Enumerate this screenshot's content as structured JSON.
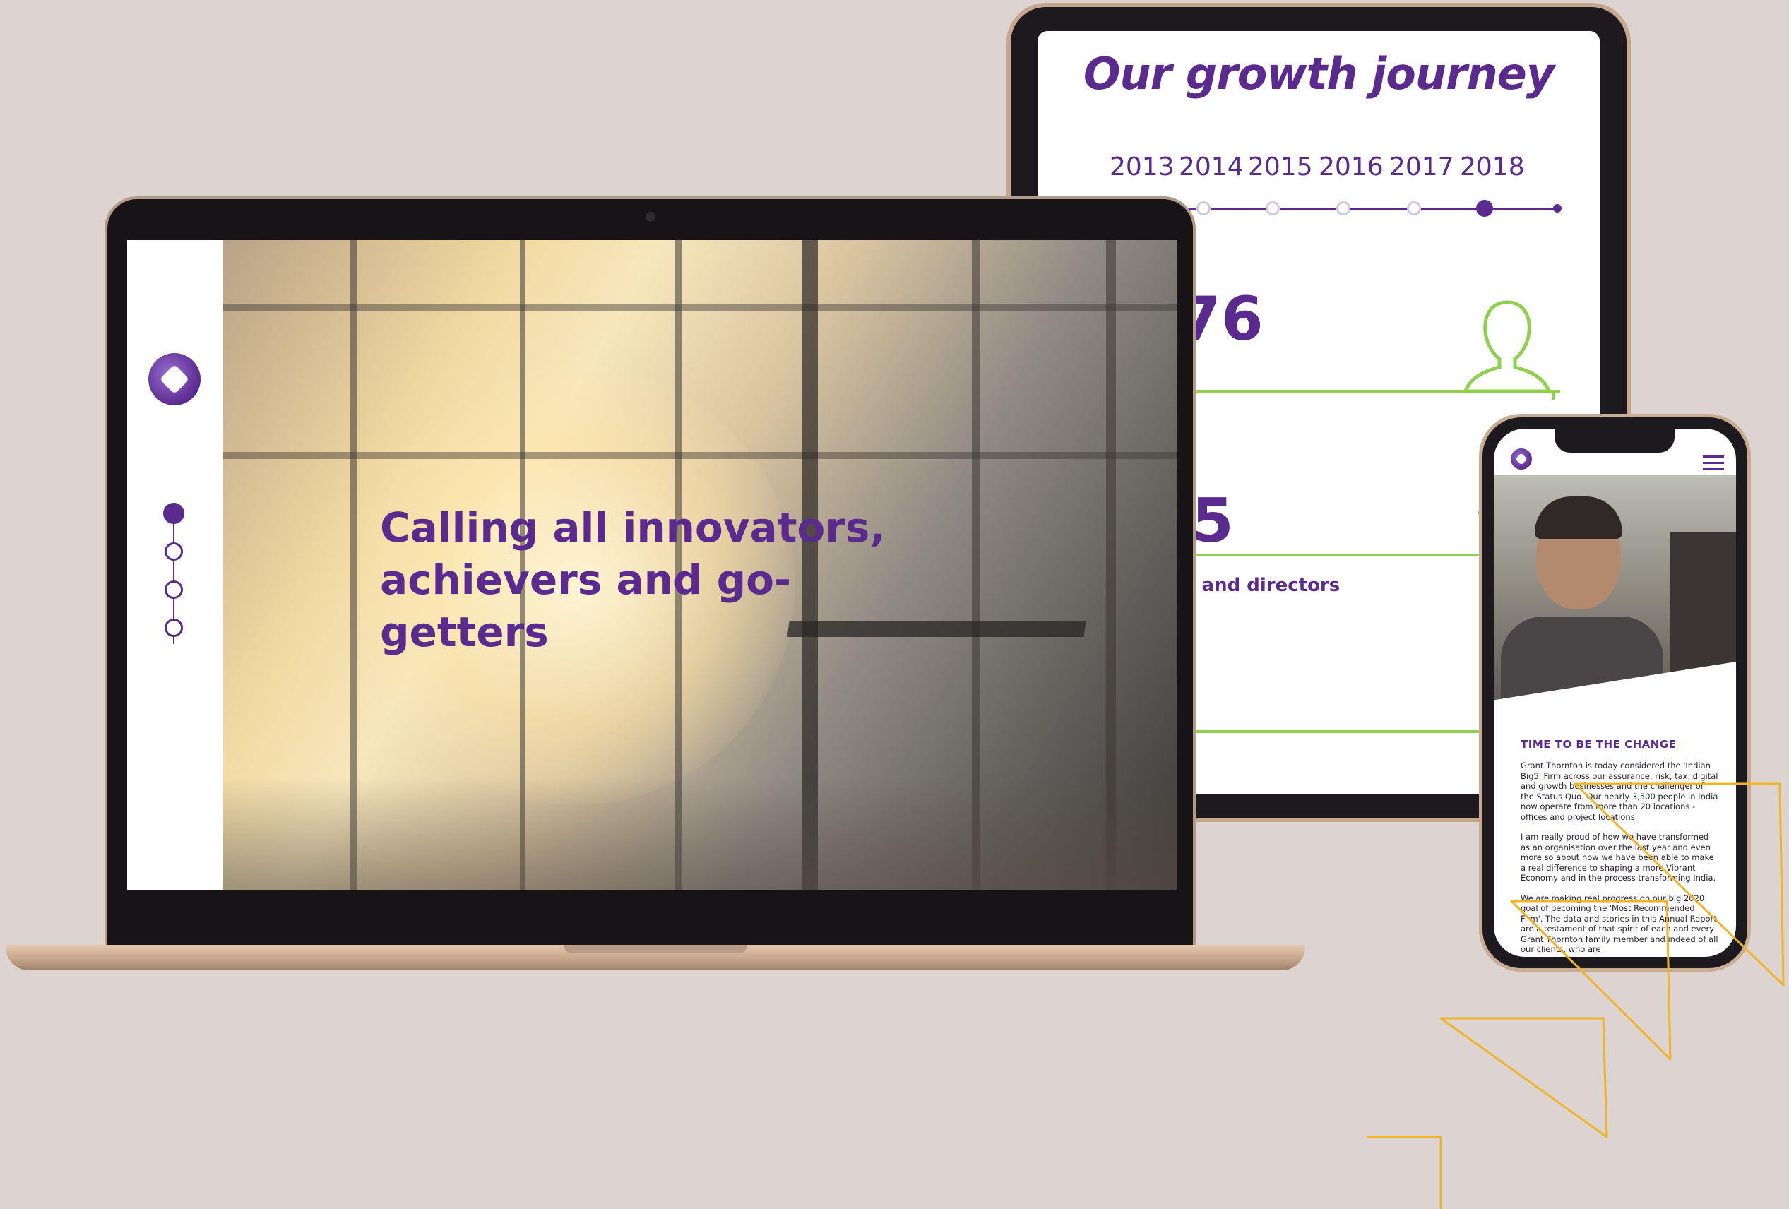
{
  "tablet": {
    "title": "Our growth journey",
    "years": [
      "2013",
      "2014",
      "2015",
      "2016",
      "2017",
      "2018"
    ],
    "active_year": "2018",
    "stat1_value": "76",
    "stat2_value": "5",
    "stat2_label": "s and directors"
  },
  "laptop": {
    "hero_line1": "Calling all innovators,",
    "hero_line2": "achievers and go-getters",
    "nav_dots": 4,
    "active_nav": 0
  },
  "phone": {
    "heading": "TIME TO BE THE CHANGE",
    "paragraphs": [
      "Grant Thornton is today considered the 'Indian Big5' Firm across our assurance, risk, tax, digital and growth businesses and the challenger of the Status Quo. Our nearly 3,500 people in India now operate from more than 20 locations - offices and project locations.",
      "I am really proud of how we have transformed as an organisation over the last year and even more so about how we have been able to make a real difference to shaping a more Vibrant Economy and in the process transforming India.",
      "We are making real progress on our big 2020 goal of becoming the 'Most Recommended Firm'. The data and stories in this Annual Report are a testament of that spirit of each and every Grant Thornton family member and indeed of all our clients, who are"
    ]
  },
  "colors": {
    "brand_purple": "#5b2a8e",
    "accent_green": "#8fd14f",
    "accent_yellow": "#f0b42a",
    "background": "#dcd4d0"
  },
  "icons": [
    "logo-icon",
    "person-icon",
    "menu-icon"
  ]
}
